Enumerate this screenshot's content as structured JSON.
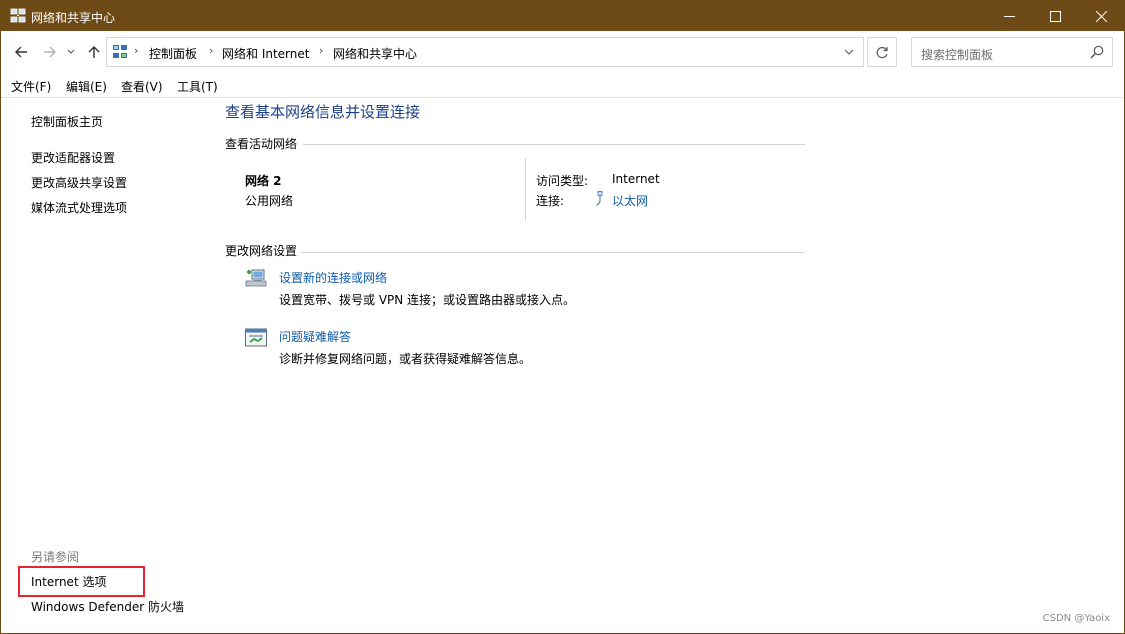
{
  "window": {
    "title": "网络和共享中心"
  },
  "nav": {
    "breadcrumbs": [
      "控制面板",
      "网络和 Internet",
      "网络和共享中心"
    ],
    "search_placeholder": "搜索控制面板"
  },
  "menubar": [
    "文件(F)",
    "编辑(E)",
    "查看(V)",
    "工具(T)"
  ],
  "sidebar": {
    "links": [
      "控制面板主页",
      "更改适配器设置",
      "更改高级共享设置",
      "媒体流式处理选项"
    ],
    "see_also_label": "另请参阅",
    "see_also": [
      "Internet 选项",
      "Windows Defender 防火墙"
    ]
  },
  "main": {
    "title": "查看基本网络信息并设置连接",
    "active_networks_heading": "查看活动网络",
    "network": {
      "name": "网络 2",
      "category": "公用网络",
      "access_type_label": "访问类型:",
      "access_type_value": "Internet",
      "connection_label": "连接:",
      "connection_value": "以太网"
    },
    "change_settings_heading": "更改网络设置",
    "tasks": [
      {
        "icon": "network-setup-icon",
        "link": "设置新的连接或网络",
        "desc": "设置宽带、拨号或 VPN 连接；或设置路由器或接入点。"
      },
      {
        "icon": "troubleshoot-icon",
        "link": "问题疑难解答",
        "desc": "诊断并修复网络问题，或者获得疑难解答信息。"
      }
    ]
  },
  "watermark": "CSDN @Yaoix",
  "colors": {
    "titlebar": "#6e4a16",
    "link": "#0f5ba8",
    "heading": "#1e3f8a",
    "highlight": "#e8222e"
  }
}
